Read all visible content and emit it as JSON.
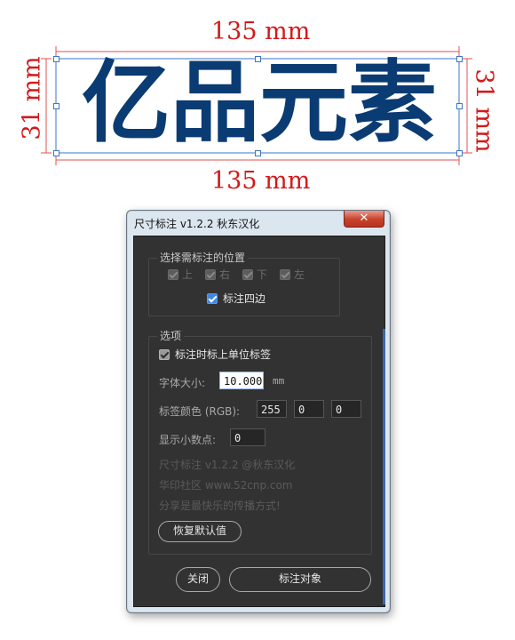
{
  "artboard": {
    "sample_text": "亿品元素",
    "top_dimension": "135 mm",
    "bottom_dimension": "135 mm",
    "left_dimension": "31 mm",
    "right_dimension": "31 mm",
    "colors": {
      "text": "#0a3c73",
      "dimension": "#d21a1a"
    }
  },
  "dialog": {
    "title": "尺寸标注 v1.2.2 秋东汉化",
    "close_label": "✕",
    "position_group": {
      "legend": "选择需标注的位置",
      "sides": [
        "上",
        "右",
        "下",
        "左"
      ],
      "all_sides_label": "标注四边"
    },
    "options_group": {
      "legend": "选项",
      "unit_label_option": "标注时标上单位标签",
      "font_size_label": "字体大小:",
      "font_size_value": "10.000",
      "font_size_unit": "mm",
      "color_label": "标签颜色 (RGB):",
      "rgb": [
        "255",
        "0",
        "0"
      ],
      "decimal_label": "显示小数点:",
      "decimal_value": "0",
      "info_lines": [
        "尺寸标注 v1.2.2 @秋东汉化",
        "华印社区 www.52cnp.com",
        "分享是最快乐的传播方式!"
      ],
      "reset_button": "恢复默认值"
    },
    "close_button": "关闭",
    "annotate_button": "标注对象"
  }
}
